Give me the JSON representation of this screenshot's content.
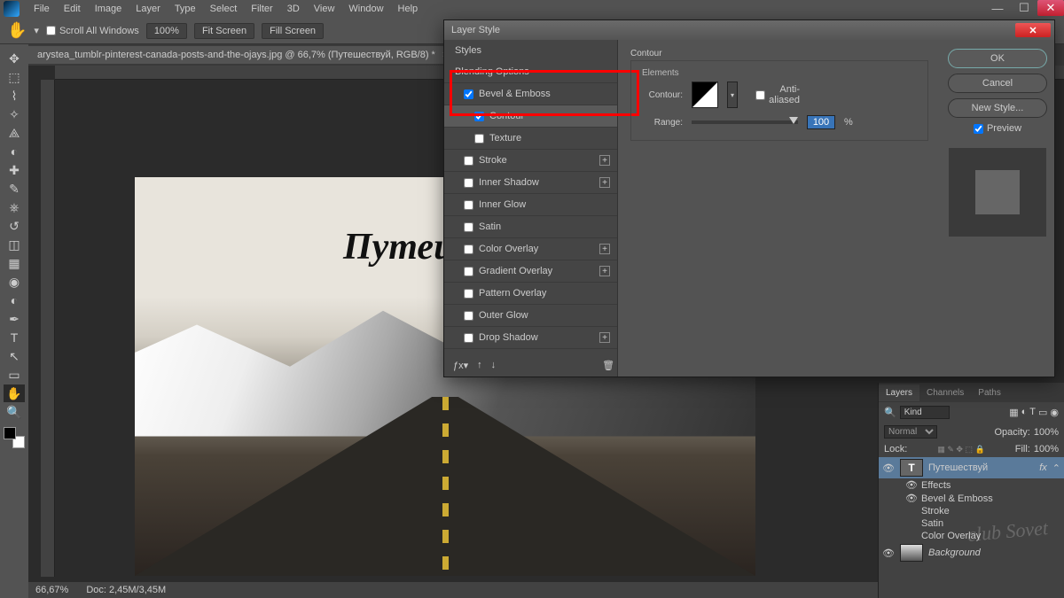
{
  "menu": [
    "File",
    "Edit",
    "Image",
    "Layer",
    "Type",
    "Select",
    "Filter",
    "3D",
    "View",
    "Window",
    "Help"
  ],
  "optbar": {
    "scroll": "Scroll All Windows",
    "zoom": "100%",
    "b1": "Fit Screen",
    "b2": "Fill Screen"
  },
  "tab": {
    "name": "arystea_tumblr-pinterest-canada-posts-and-the-ojays.jpg @ 66,7% (Путешествуй, RGB/8) *"
  },
  "canvas_text": "Путеш",
  "status": {
    "zoom": "66,67%",
    "doc": "Doc: 2,45M/3,45M"
  },
  "dialog": {
    "title": "Layer Style",
    "styles_hdr": "Styles",
    "blend_hdr": "Blending Options",
    "items": [
      {
        "label": "Bevel & Emboss",
        "checked": true,
        "sub": false,
        "plus": false
      },
      {
        "label": "Contour",
        "checked": true,
        "sub": true,
        "plus": false,
        "sel": true
      },
      {
        "label": "Texture",
        "checked": false,
        "sub": true,
        "plus": false
      },
      {
        "label": "Stroke",
        "checked": false,
        "sub": false,
        "plus": true
      },
      {
        "label": "Inner Shadow",
        "checked": false,
        "sub": false,
        "plus": true
      },
      {
        "label": "Inner Glow",
        "checked": false,
        "sub": false,
        "plus": false
      },
      {
        "label": "Satin",
        "checked": false,
        "sub": false,
        "plus": false
      },
      {
        "label": "Color Overlay",
        "checked": false,
        "sub": false,
        "plus": true
      },
      {
        "label": "Gradient Overlay",
        "checked": false,
        "sub": false,
        "plus": true
      },
      {
        "label": "Pattern Overlay",
        "checked": false,
        "sub": false,
        "plus": false
      },
      {
        "label": "Outer Glow",
        "checked": false,
        "sub": false,
        "plus": false
      },
      {
        "label": "Drop Shadow",
        "checked": false,
        "sub": false,
        "plus": true
      }
    ],
    "section": "Contour",
    "elements": "Elements",
    "contour_lbl": "Contour:",
    "aa": "Anti-aliased",
    "range_lbl": "Range:",
    "range_val": "100",
    "pct": "%",
    "btns": {
      "ok": "OK",
      "cancel": "Cancel",
      "new": "New Style...",
      "preview": "Preview"
    }
  },
  "panels": {
    "tabs": [
      "Layers",
      "Channels",
      "Paths"
    ],
    "kind": "Kind",
    "mode": "Normal",
    "opacity_lbl": "Opacity:",
    "opacity": "100%",
    "lock_lbl": "Lock:",
    "fill_lbl": "Fill:",
    "fill": "100%",
    "layer1": "Путешествуй",
    "fx": "fx",
    "effects": "Effects",
    "eff_items": [
      "Bevel & Emboss",
      "Stroke",
      "Satin",
      "Color Overlay"
    ],
    "bg": "Background"
  },
  "watermark": "club Sovet"
}
